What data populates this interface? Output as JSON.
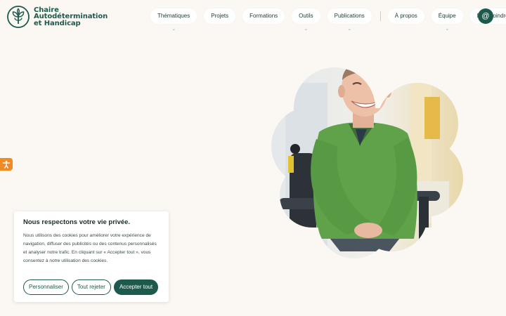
{
  "logo": {
    "line1": "Chaire",
    "line2": "Autodétermination",
    "line3": "et Handicap",
    "icon": "tree-circle-logo"
  },
  "nav": {
    "items": [
      {
        "label": "Thématiques",
        "has_dropdown": true
      },
      {
        "label": "Projets",
        "has_dropdown": false
      },
      {
        "label": "Formations",
        "has_dropdown": false
      },
      {
        "label": "Outils",
        "has_dropdown": true
      },
      {
        "label": "Publications",
        "has_dropdown": true
      },
      {
        "label": "À propos",
        "has_dropdown": false
      },
      {
        "label": "Équipe",
        "has_dropdown": true
      },
      {
        "label": "Nous joindre",
        "has_dropdown": false
      }
    ],
    "contact_icon": "at-icon",
    "chevron_glyph": "⌄"
  },
  "accessibility": {
    "icon": "accessibility-icon"
  },
  "cookie": {
    "title": "Nous respectons votre vie privée.",
    "body": "Nous utilisons des cookies pour améliorer votre expérience de navigation, diffuser des publicités ou des contenus personnalisés et analyser notre trafic. En cliquant sur « Accepter tout », vous consentez à notre utilisation des cookies.",
    "customize_label": "Personnaliser",
    "reject_label": "Tout rejeter",
    "accept_label": "Accepter tout"
  },
  "colors": {
    "brand": "#1d5a4e",
    "background": "#fbf8f4",
    "accessibility_orange": "#f08a24",
    "sweater_green": "#5fa24a"
  }
}
